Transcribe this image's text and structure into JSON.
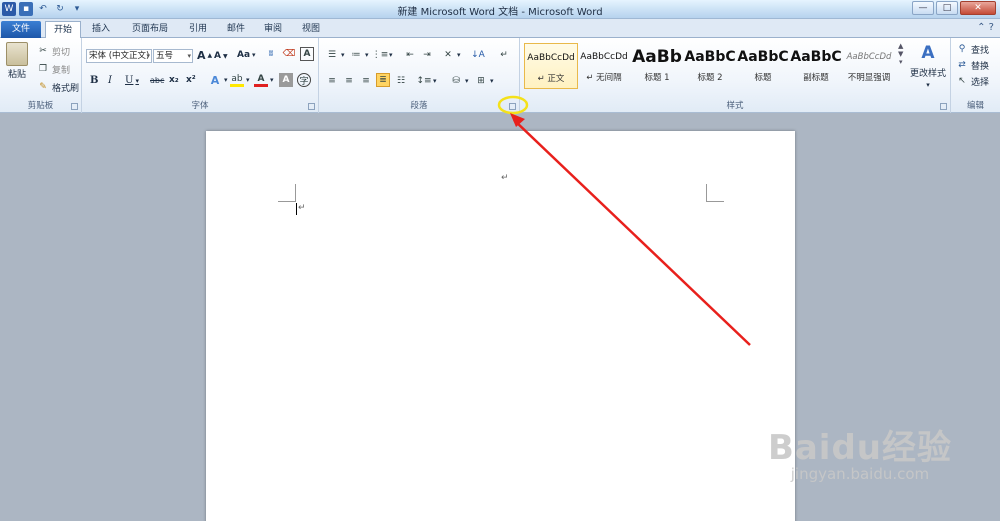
{
  "window": {
    "title": "新建 Microsoft Word 文档 - Microsoft Word",
    "controls": [
      "—",
      "□",
      "✕"
    ]
  },
  "tabs": {
    "file": "文件",
    "items": [
      "开始",
      "插入",
      "页面布局",
      "引用",
      "邮件",
      "审阅",
      "视图"
    ]
  },
  "clipboard": {
    "paste": "粘贴",
    "cut": "剪切",
    "copy": "复制",
    "format_painter": "格式刷",
    "group_label": "剪贴板"
  },
  "font": {
    "font_name": "宋体 (中文正文)",
    "font_size": "五号",
    "grow": "A",
    "shrink": "A",
    "change_case": "Aa",
    "bold": "B",
    "italic": "I",
    "underline": "U",
    "strikethrough": "abc",
    "subscript": "x₂",
    "superscript": "x²",
    "group_label": "字体"
  },
  "paragraph": {
    "group_label": "段落"
  },
  "styles": {
    "items": [
      {
        "preview": "AaBbCcDd",
        "label": "↵ 正文"
      },
      {
        "preview": "AaBbCcDd",
        "label": "↵ 无间隔"
      },
      {
        "preview": "AaBb",
        "label": "标题 1"
      },
      {
        "preview": "AaBbC",
        "label": "标题 2"
      },
      {
        "preview": "AaBbC",
        "label": "标题"
      },
      {
        "preview": "AaBbC",
        "label": "副标题"
      },
      {
        "preview": "AaBbCcDd",
        "label": "不明显强调"
      }
    ],
    "change_styles": "更改样式",
    "group_label": "样式"
  },
  "editing": {
    "find": "查找",
    "replace": "替换",
    "select": "选择",
    "group_label": "编辑"
  },
  "document": {
    "paragraph_mark": "↵"
  },
  "watermark": {
    "brand": "Baidu经验",
    "url": "jingyan.baidu.com"
  },
  "annotation": {
    "arrow_color": "#e8201c",
    "highlight_color": "#f4e11a"
  }
}
